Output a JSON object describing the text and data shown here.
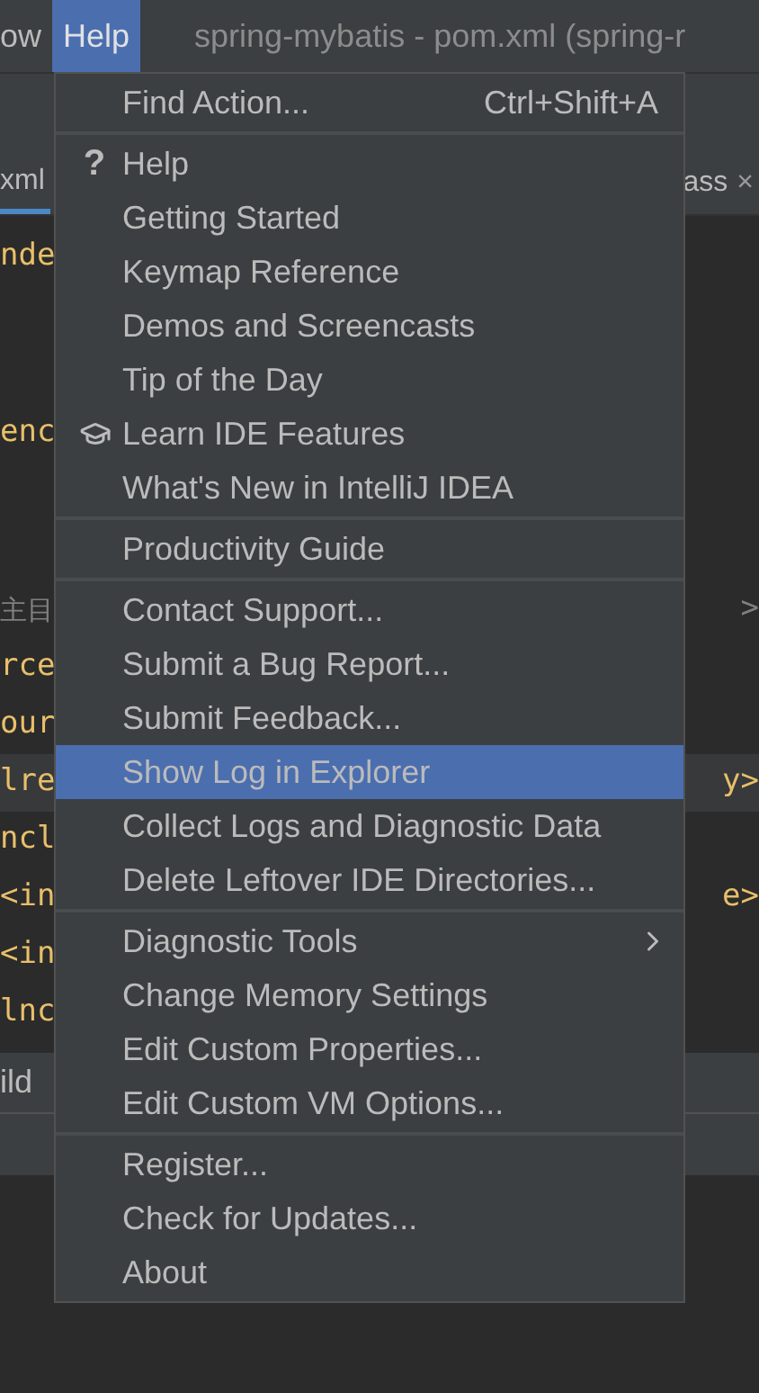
{
  "menu_bar": [
    {
      "label": "ow",
      "selected": false
    },
    {
      "label": "Help",
      "selected": true
    }
  ],
  "window": {
    "title": "spring-mybatis - pom.xml (spring-r"
  },
  "editor_tabs": [
    {
      "label": "xml",
      "selected": true
    },
    {
      "label": "ass",
      "close": "×",
      "selected": false
    }
  ],
  "editor_lines": [
    {
      "left": "nde",
      "highlight": false
    },
    {
      "left": "enc",
      "highlight": false
    },
    {
      "left": "主目",
      "kind": "comment",
      "right": ">",
      "highlight": false
    },
    {
      "left": "rce",
      "highlight": false
    },
    {
      "left": "our",
      "highlight": false
    },
    {
      "left": "lre",
      "right": "y>",
      "highlight": true
    },
    {
      "left": "ncl",
      "highlight": false
    },
    {
      "left": "<in",
      "right": "e>",
      "highlight": false
    },
    {
      "left": "<in",
      "highlight": false
    },
    {
      "left": "lnc",
      "highlight": false
    }
  ],
  "tool_window": {
    "label": "ild"
  },
  "help_menu": [
    [
      {
        "label": "Find Action...",
        "shortcut": "Ctrl+Shift+A",
        "selected": false
      }
    ],
    [
      {
        "label": "Help",
        "icon": "?",
        "selected": false
      },
      {
        "label": "Getting Started",
        "selected": false
      },
      {
        "label": "Keymap Reference",
        "selected": false
      },
      {
        "label": "Demos and Screencasts",
        "selected": false
      },
      {
        "label": "Tip of the Day",
        "selected": false
      },
      {
        "label": "Learn IDE Features",
        "kind": "learn",
        "selected": false
      },
      {
        "label": "What's New in IntelliJ IDEA",
        "selected": false
      }
    ],
    [
      {
        "label": "Productivity Guide",
        "selected": false
      }
    ],
    [
      {
        "label": "Contact Support...",
        "selected": false
      },
      {
        "label": "Submit a Bug Report...",
        "selected": false
      },
      {
        "label": "Submit Feedback...",
        "selected": false
      },
      {
        "label": "Show Log in Explorer",
        "selected": true
      },
      {
        "label": "Collect Logs and Diagnostic Data",
        "selected": false
      },
      {
        "label": "Delete Leftover IDE Directories...",
        "selected": false
      }
    ],
    [
      {
        "label": "Diagnostic Tools",
        "submenu": true,
        "selected": false
      },
      {
        "label": "Change Memory Settings",
        "selected": false
      },
      {
        "label": "Edit Custom Properties...",
        "selected": false
      },
      {
        "label": "Edit Custom VM Options...",
        "selected": false
      }
    ],
    [
      {
        "label": "Register...",
        "selected": false
      },
      {
        "label": "Check for Updates...",
        "selected": false
      },
      {
        "label": "About",
        "selected": false
      }
    ]
  ]
}
